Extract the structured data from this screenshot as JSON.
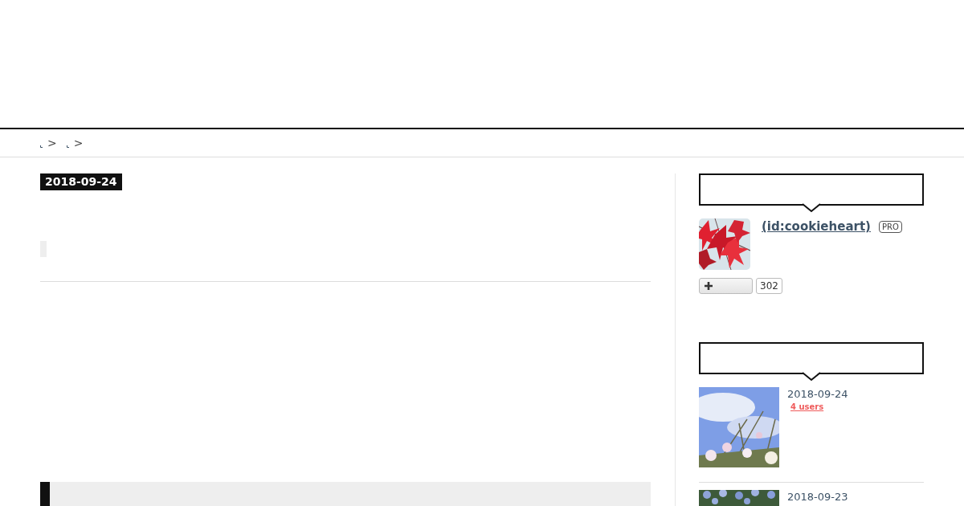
{
  "breadcrumb": [
    {
      "separator": ">"
    },
    {
      "separator": ">"
    }
  ],
  "entry": {
    "date": "2018-09-24"
  },
  "profile": {
    "handle": "(id:cookieheart)",
    "badge": "PRO",
    "subscribe_count": "302"
  },
  "recent_entries": [
    {
      "date": "2018-09-24",
      "bookmarks": "4 users"
    },
    {
      "date": "2018-09-23"
    }
  ]
}
